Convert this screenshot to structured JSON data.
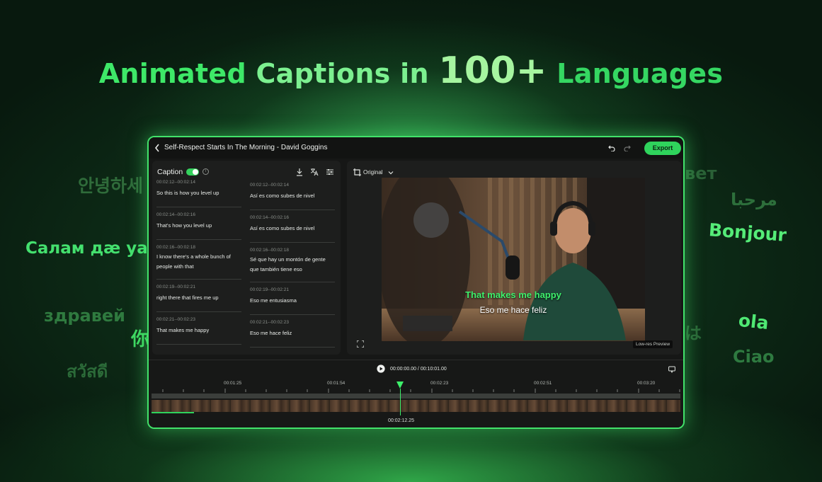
{
  "headline": {
    "part1": "Animated",
    "part2": "Captions in",
    "big": "100+",
    "part3": "Languages"
  },
  "floating_words": [
    {
      "text": "안녕하세",
      "color": "#2f6b3a"
    },
    {
      "text": "Салам дæ уа",
      "color": "#44e06e"
    },
    {
      "text": "здравей",
      "color": "#2f7a3f"
    },
    {
      "text": "你",
      "color": "#3fd862"
    },
    {
      "text": "สวัสดี",
      "color": "#2b6a38"
    },
    {
      "text": "вет",
      "color": "#2a6136"
    },
    {
      "text": "مرحبا",
      "color": "#2d6f3b"
    },
    {
      "text": "Bonjour",
      "color": "#55ec78"
    },
    {
      "text": "ola",
      "color": "#4fe873"
    },
    {
      "text": "Ciao",
      "color": "#2e7a40"
    },
    {
      "text": "は",
      "color": "#2a6537"
    }
  ],
  "app": {
    "title": "Self-Respect Starts In The Morning - David Goggins",
    "export_label": "Export",
    "caption_label": "Caption",
    "icons": {
      "back": "chevron-left-icon",
      "undo": "undo-icon",
      "redo": "redo-icon",
      "download": "download-icon",
      "translate": "translate-icon",
      "settings": "sliders-icon"
    },
    "captions_original": [
      {
        "time": "00:02:12--00:02:14",
        "text": "So this is how you level up"
      },
      {
        "time": "00:02:14--00:02:16",
        "text": "That's how you level up"
      },
      {
        "time": "00:02:16--00:02:18",
        "text": "I know there's a whole bunch of people with that"
      },
      {
        "time": "00:02:19--00:02:21",
        "text": "right there that fires me up"
      },
      {
        "time": "00:02:21--00:02:23",
        "text": "That makes me happy"
      }
    ],
    "captions_translated": [
      {
        "time": "00:02:12--00:02:14",
        "text": "Así es como subes de nivel"
      },
      {
        "time": "00:02:14--00:02:16",
        "text": "Así es como subes de nivel"
      },
      {
        "time": "00:02:16--00:02:18",
        "text": "Sé que hay un montón de gente que también tiene eso"
      },
      {
        "time": "00:02:19--00:02:21",
        "text": "Eso me entusiasma"
      },
      {
        "time": "00:02:21--00:02:23",
        "text": "Eso me hace feliz"
      }
    ],
    "preview": {
      "ratio_label": "Original",
      "subtitle_primary": "That makes me happy",
      "subtitle_secondary": "Eso me hace feliz",
      "lowres_label": "Low-res Preview"
    },
    "timeline": {
      "timecode": "00:00:00.00 / 00:10:01.00",
      "ticks": [
        "00:01:25",
        "00:01:54",
        "00:02:23",
        "00:02:51",
        "00:03:20"
      ],
      "playhead_time": "00:02:12.25"
    },
    "colors": {
      "accent": "#2fd35c",
      "subtitle_green": "#3ef16c"
    }
  }
}
